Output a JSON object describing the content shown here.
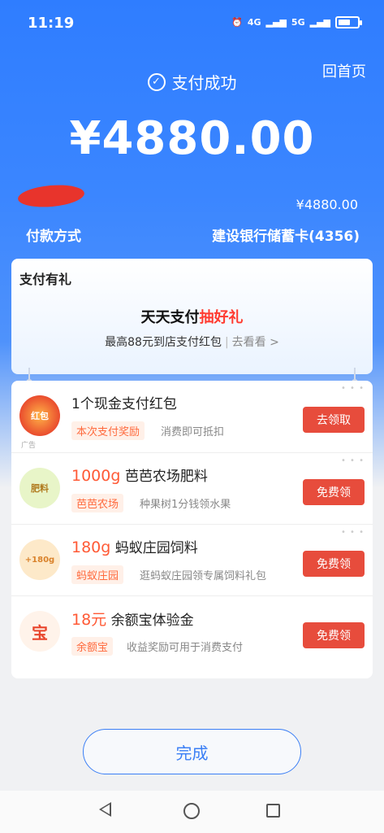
{
  "status_bar": {
    "time": "11:19",
    "network_1": "4G",
    "network_2": "5G"
  },
  "header": {
    "home_link": "回首页",
    "success_text": "支付成功",
    "amount": "¥4880.00"
  },
  "payment": {
    "amount_small": "¥4880.00",
    "method_label": "付款方式",
    "method_value": "建设银行储蓄卡(4356)"
  },
  "gift_card": {
    "title": "支付有礼",
    "headline_prefix": "天天支付",
    "headline_highlight": "抽好礼",
    "sub_text": "最高88元到店支付红包",
    "sub_separator": "|",
    "sub_link": "去看看 >",
    "colors": {
      "highlight": "#ff3b30"
    }
  },
  "offers": [
    {
      "icon": "red-packet-icon",
      "avatar_text": "红包",
      "title_num": "",
      "title": "1个现金支付红包",
      "tag": "本次支付奖励",
      "desc": "消费即可抵扣",
      "button": "去领取",
      "ad_label": "广告"
    },
    {
      "icon": "fertilizer-icon",
      "avatar_text": "肥料",
      "title_num": "1000g",
      "title": " 芭芭农场肥料",
      "tag": "芭芭农场",
      "desc": "种果树1分钱领水果",
      "button": "免费领"
    },
    {
      "icon": "feed-icon",
      "avatar_text": "+180g",
      "title_num": "180g",
      "title": " 蚂蚁庄园饲料",
      "tag": "蚂蚁庄园",
      "desc": "逛蚂蚁庄园领专属饲料礼包",
      "button": "免费领"
    },
    {
      "icon": "yuebao-icon",
      "avatar_text": "宝",
      "title_num": "18元",
      "title": " 余额宝体验金",
      "tag": "余额宝",
      "desc": "收益奖励可用于消费支付",
      "button": "免费领"
    }
  ],
  "footer": {
    "done_button": "完成"
  },
  "colors": {
    "primary_blue": "#3b7ff5",
    "button_red": "#e74c3c",
    "orange_accent": "#ff5a36"
  }
}
